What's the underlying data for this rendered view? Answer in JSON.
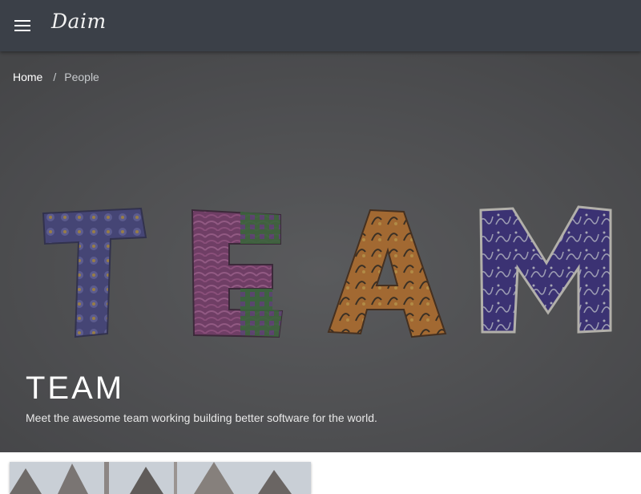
{
  "header": {
    "brand": "Daim",
    "menu_icon": "hamburger-menu-icon"
  },
  "breadcrumb": {
    "home": "Home",
    "separator": "/",
    "current": "People"
  },
  "hero": {
    "title": "TEAM",
    "subtitle": "Meet the awesome team working building better software for the world.",
    "image_letters": [
      "T",
      "E",
      "A",
      "M"
    ]
  },
  "colors": {
    "topbar": "#3b4048",
    "hero_overlay": "#5a5b5d",
    "letter_t": "#4b4a93",
    "letter_e": "#8a3f7a",
    "letter_a": "#d9822b",
    "letter_m": "#3b2d8f"
  }
}
